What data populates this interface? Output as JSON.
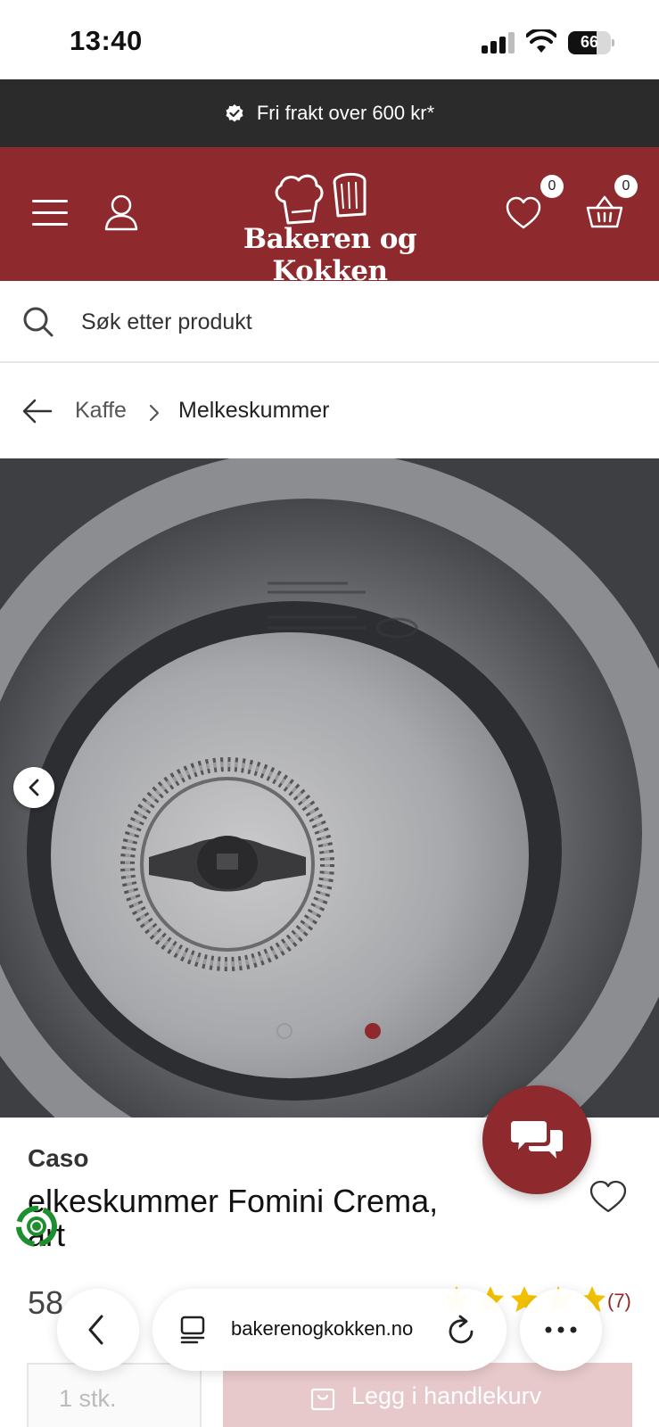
{
  "status_bar": {
    "time": "13:40",
    "battery": "66"
  },
  "promo": {
    "text": "Fri frakt over 600 kr*",
    "icon": "check-badge-icon"
  },
  "header": {
    "logo_text": "Bakeren og Kokken",
    "wishlist_count": "0",
    "cart_count": "0",
    "background": "#8e2a2d"
  },
  "search": {
    "placeholder": "Søk etter produkt"
  },
  "breadcrumb": {
    "items": [
      "Kaffe",
      "Melkeskummer"
    ]
  },
  "gallery": {
    "slide_count": 2,
    "active_slide": 2
  },
  "product": {
    "brand": "Caso",
    "title_line1": "elkeskummer Fomini Crema,",
    "title_line2": "art",
    "price": "58",
    "rating": 5,
    "review_count": "(7)"
  },
  "purchase": {
    "quantity": "1  stk.",
    "add_label": "Legg i handlekurv"
  },
  "browser": {
    "url": "bakerenogkokken.no"
  },
  "colors": {
    "brand": "#8e2a2d",
    "promo_bg": "#2b2b2b",
    "star": "#f2c200"
  }
}
